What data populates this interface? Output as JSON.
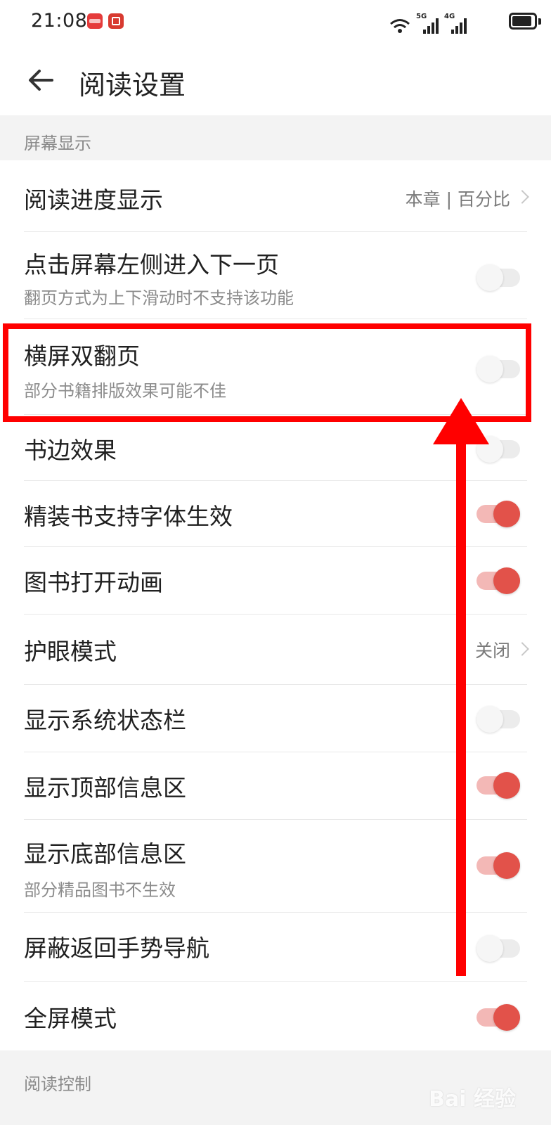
{
  "status_bar": {
    "time": "21:08",
    "network_5g": "5G",
    "network_4g": "4G"
  },
  "header": {
    "title": "阅读设置"
  },
  "sections": {
    "screen_display": "屏幕显示",
    "reading_control": "阅读控制"
  },
  "settings": {
    "reading_progress": {
      "title": "阅读进度显示",
      "value": "本章 | 百分比"
    },
    "tap_left_next": {
      "title": "点击屏幕左侧进入下一页",
      "subtitle": "翻页方式为上下滑动时不支持该功能",
      "enabled": false
    },
    "landscape_double": {
      "title": "横屏双翻页",
      "subtitle": "部分书籍排版效果可能不佳",
      "enabled": false
    },
    "book_edge": {
      "title": "书边效果",
      "enabled": false
    },
    "hardcover_font": {
      "title": "精装书支持字体生效",
      "enabled": true
    },
    "open_animation": {
      "title": "图书打开动画",
      "enabled": true
    },
    "eye_care": {
      "title": "护眼模式",
      "value": "关闭"
    },
    "show_system_bar": {
      "title": "显示系统状态栏",
      "enabled": false
    },
    "show_top_info": {
      "title": "显示顶部信息区",
      "enabled": true
    },
    "show_bottom_info": {
      "title": "显示底部信息区",
      "subtitle": "部分精品图书不生效",
      "enabled": true
    },
    "block_back_gesture": {
      "title": "屏蔽返回手势导航",
      "enabled": false
    },
    "fullscreen": {
      "title": "全屏模式",
      "enabled": true
    }
  },
  "watermark": "Bai 经验",
  "colors": {
    "accent": "#e2524a",
    "annotation": "#ff0000",
    "section_bg": "#f3f3f3"
  }
}
